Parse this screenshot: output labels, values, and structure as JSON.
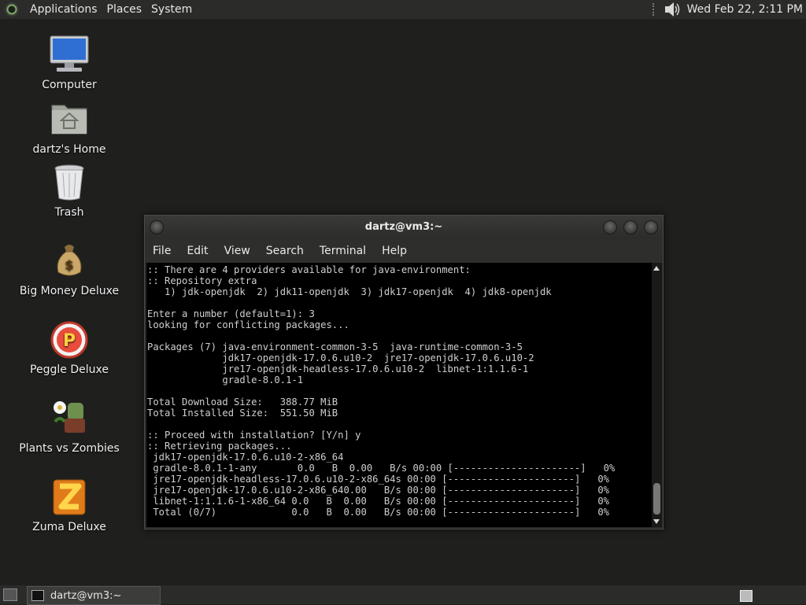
{
  "top_panel": {
    "menus": [
      "Applications",
      "Places",
      "System"
    ],
    "clock": "Wed Feb 22,  2:11 PM"
  },
  "desktop": {
    "icons": [
      {
        "label": "Computer",
        "icon": "computer-icon"
      },
      {
        "label": "dartz's Home",
        "icon": "home-folder-icon"
      },
      {
        "label": "Trash",
        "icon": "trash-icon"
      },
      {
        "label": "Big Money Deluxe",
        "icon": "money-bag-icon"
      },
      {
        "label": "Peggle Deluxe",
        "icon": "peggle-icon"
      },
      {
        "label": "Plants vs Zombies",
        "icon": "plants-vs-zombies-icon"
      },
      {
        "label": "Zuma Deluxe",
        "icon": "zuma-icon"
      }
    ]
  },
  "window": {
    "title": "dartz@vm3:~",
    "menu": [
      "File",
      "Edit",
      "View",
      "Search",
      "Terminal",
      "Help"
    ],
    "terminal_text": ":: There are 4 providers available for java-environment:\n:: Repository extra\n   1) jdk-openjdk  2) jdk11-openjdk  3) jdk17-openjdk  4) jdk8-openjdk\n\nEnter a number (default=1): 3\nlooking for conflicting packages...\n\nPackages (7) java-environment-common-3-5  java-runtime-common-3-5\n             jdk17-openjdk-17.0.6.u10-2  jre17-openjdk-17.0.6.u10-2\n             jre17-openjdk-headless-17.0.6.u10-2  libnet-1:1.1.6-1\n             gradle-8.0.1-1\n\nTotal Download Size:   388.77 MiB\nTotal Installed Size:  551.50 MiB\n\n:: Proceed with installation? [Y/n] y\n:: Retrieving packages...\n jdk17-openjdk-17.0.6.u10-2-x86_64\n gradle-8.0.1-1-any       0.0   B  0.00   B/s 00:00 [----------------------]   0%\n jre17-openjdk-headless-17.0.6.u10-2-x86_64s 00:00 [----------------------]   0%\n jre17-openjdk-17.0.6.u10-2-x86_640.00   B/s 00:00 [----------------------]   0%\n libnet-1:1.1.6-1-x86_64 0.0   B  0.00   B/s 00:00 [----------------------]   0%\n Total (0/7)             0.0   B  0.00   B/s 00:00 [----------------------]   0%"
  },
  "bottom_panel": {
    "task_label": "dartz@vm3:~"
  }
}
